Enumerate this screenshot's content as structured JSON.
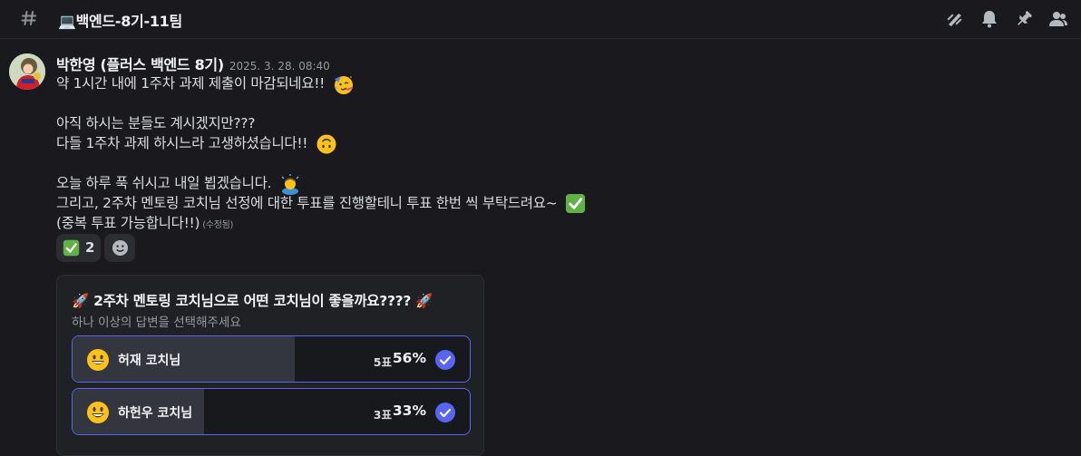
{
  "channel": {
    "icon": "hash-icon",
    "name": "💻백엔드-8기-11팀"
  },
  "header_actions": [
    {
      "icon": "threads-icon"
    },
    {
      "icon": "bell-icon"
    },
    {
      "icon": "pin-icon"
    },
    {
      "icon": "members-icon"
    }
  ],
  "message": {
    "author": "박한영 (플러스 백엔드 8기)",
    "timestamp": "2025. 3. 28. 08:40",
    "lines": [
      "약 1시간 내에 1주차 과제 제출이 마감되네요!!",
      "아직 하시는 분들도 계시겠지만???",
      "다들 1주차 과제 하시느라 고생하셨습니다!!",
      "오늘 하루 푹 쉬시고 내일 뵙겠습니다.",
      "그리고, 2주차 멘토링 코치님 선정에 대한 투표를 진행할테니 투표 한번 씩 부탁드려요~",
      "(중복 투표 가능합니다!!)"
    ],
    "edited": "(수정됨)"
  },
  "reactions": [
    {
      "emoji": "check-mark-emoji",
      "count": "2"
    },
    {
      "icon": "add-reaction-icon"
    }
  ],
  "poll": {
    "question": "🚀 2주차 멘토링 코치님으로 어떤 코치님이 좋을까요???? 🚀",
    "subtitle": "하나 이상의 답변을 선택해주세요",
    "accent": "#5865f2",
    "options": [
      {
        "label": "허재 코치님",
        "votes": "5표",
        "percent": "56%",
        "share": 0.56,
        "selected": true
      },
      {
        "label": "하헌우 코치님",
        "votes": "3표",
        "percent": "33%",
        "share": 0.33,
        "selected": true
      }
    ]
  }
}
